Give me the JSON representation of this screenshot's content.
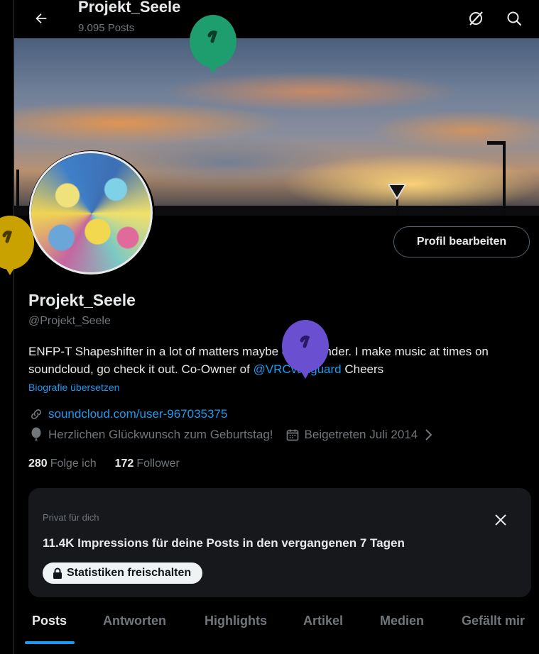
{
  "header": {
    "title": "Projekt_Seele",
    "subtitle": "9.095 Posts",
    "icons": [
      "back-arrow-icon",
      "grok-icon",
      "search-icon"
    ]
  },
  "profile": {
    "edit_button": "Profil bearbeiten",
    "name": "Projekt_Seele",
    "handle": "@Projekt_Seele",
    "bio_part1": "ENFP-T Shapeshifter in a lot of matters maybe even gender. I make music at times on soundcloud, go check it out. Co-Owner of ",
    "bio_mention": "@VRCvanguard",
    "bio_part2": " Cheers",
    "translate": "Biografie übersetzen",
    "link": "soundcloud.com/user-967035375",
    "birthday": "Herzlichen Glückwunsch zum Geburtstag!",
    "joined": "Beigetreten Juli 2014",
    "following_count": "280",
    "following_label": "Folge ich",
    "followers_count": "172",
    "followers_label": "Follower"
  },
  "card": {
    "label": "Privat für dich",
    "text": "11.4K Impressions für deine Posts in den vergangenen 7 Tagen",
    "button": "Statistiken freischalten"
  },
  "tabs": [
    "Posts",
    "Antworten",
    "Highlights",
    "Artikel",
    "Medien",
    "Gefällt mir"
  ],
  "active_tab": "Posts",
  "colors": {
    "accent": "#1d9bf0",
    "balloon_green": "#1e9e6e",
    "balloon_yellow": "#c9a200",
    "balloon_purple": "#6a4fd0"
  }
}
